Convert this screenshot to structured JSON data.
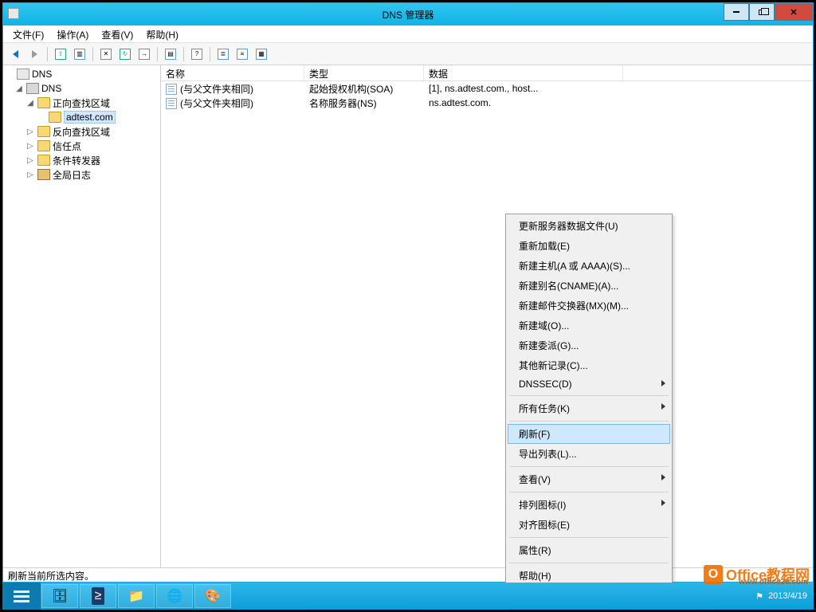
{
  "window": {
    "title": "DNS 管理器"
  },
  "menu": {
    "file": "文件(F)",
    "action": "操作(A)",
    "view": "查看(V)",
    "help": "帮助(H)"
  },
  "tree": {
    "root": "DNS",
    "server": "DNS",
    "fwd_zones": "正向查找区域",
    "selected_zone": "adtest.com",
    "rev_zones": "反向查找区域",
    "trust_points": "信任点",
    "cond_fwd": "条件转发器",
    "global_log": "全局日志"
  },
  "columns": {
    "name": "名称",
    "type": "类型",
    "data": "数据"
  },
  "records": [
    {
      "name": "(与父文件夹相同)",
      "type": "起始授权机构(SOA)",
      "data": "[1], ns.adtest.com., host..."
    },
    {
      "name": "(与父文件夹相同)",
      "type": "名称服务器(NS)",
      "data": "ns.adtest.com."
    }
  ],
  "context": {
    "update": "更新服务器数据文件(U)",
    "reload": "重新加载(E)",
    "new_host": "新建主机(A 或 AAAA)(S)...",
    "new_cname": "新建别名(CNAME)(A)...",
    "new_mx": "新建邮件交换器(MX)(M)...",
    "new_domain": "新建域(O)...",
    "new_deleg": "新建委派(G)...",
    "other_new": "其他新记录(C)...",
    "dnssec": "DNSSEC(D)",
    "all_tasks": "所有任务(K)",
    "refresh": "刷新(F)",
    "export": "导出列表(L)...",
    "view": "查看(V)",
    "arrange": "排列图标(I)",
    "align": "对齐图标(E)",
    "props": "属性(R)",
    "help": "帮助(H)"
  },
  "status": "刷新当前所选内容。",
  "tray": {
    "date": "2013/4/19"
  },
  "watermark": {
    "text": "Office教程网",
    "url": "www.office26.com"
  }
}
